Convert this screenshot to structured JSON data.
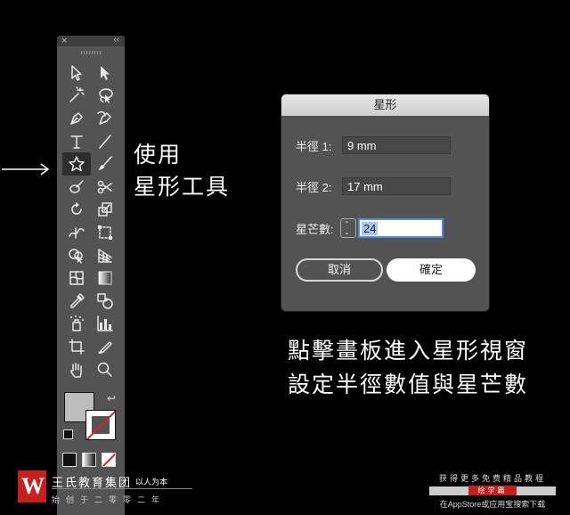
{
  "toolbar": {
    "close_glyph": "×",
    "collapse_glyph": "‹‹",
    "tools": [
      {
        "name": "selection-tool",
        "icon": "selection-arrow-icon"
      },
      {
        "name": "direct-selection-tool",
        "icon": "direct-selection-arrow-icon"
      },
      {
        "name": "magic-wand-tool",
        "icon": "magic-wand-icon"
      },
      {
        "name": "lasso-tool",
        "icon": "lasso-icon"
      },
      {
        "name": "pen-tool",
        "icon": "pen-icon"
      },
      {
        "name": "curvature-tool",
        "icon": "curvature-pen-icon"
      },
      {
        "name": "type-tool",
        "icon": "type-t-icon"
      },
      {
        "name": "line-segment-tool",
        "icon": "line-icon"
      },
      {
        "name": "star-tool",
        "icon": "star-icon",
        "selected": true
      },
      {
        "name": "paintbrush-tool",
        "icon": "paintbrush-icon"
      },
      {
        "name": "blob-brush-tool",
        "icon": "blob-brush-icon"
      },
      {
        "name": "scissors-tool",
        "icon": "scissors-icon"
      },
      {
        "name": "rotate-tool",
        "icon": "rotate-icon"
      },
      {
        "name": "scale-tool",
        "icon": "scale-icon"
      },
      {
        "name": "width-tool",
        "icon": "width-icon"
      },
      {
        "name": "free-transform-tool",
        "icon": "free-transform-icon"
      },
      {
        "name": "shape-builder-tool",
        "icon": "shape-builder-icon"
      },
      {
        "name": "perspective-grid-tool",
        "icon": "perspective-grid-icon"
      },
      {
        "name": "mesh-tool",
        "icon": "mesh-icon"
      },
      {
        "name": "gradient-tool",
        "icon": "gradient-icon"
      },
      {
        "name": "eyedropper-tool",
        "icon": "eyedropper-icon"
      },
      {
        "name": "blend-tool",
        "icon": "blend-icon"
      },
      {
        "name": "symbol-sprayer-tool",
        "icon": "symbol-sprayer-icon"
      },
      {
        "name": "column-graph-tool",
        "icon": "column-graph-icon"
      },
      {
        "name": "artboard-tool",
        "icon": "artboard-icon"
      },
      {
        "name": "slice-tool",
        "icon": "slice-icon"
      },
      {
        "name": "hand-tool",
        "icon": "hand-icon"
      },
      {
        "name": "zoom-tool",
        "icon": "zoom-icon"
      }
    ],
    "fill_color": "#bdbdbd",
    "swap_glyph": "↩"
  },
  "annotation": {
    "arrow_icon": "right-arrow-icon",
    "tool_caption_line1": "使用",
    "tool_caption_line2": "星形工具"
  },
  "dialog": {
    "title": "星形",
    "radius1_label": "半徑 1:",
    "radius1_value": "9 mm",
    "radius2_label": "半徑 2:",
    "radius2_value": "17 mm",
    "points_label": "星芒數:",
    "points_value": "24",
    "cancel_label": "取消",
    "ok_label": "確定"
  },
  "caption": {
    "line1": "點擊畫板進入星形視窗",
    "line2": "設定半徑數值與星芒數"
  },
  "brand": {
    "name": "王氏教育集团",
    "slogan": "以人为本",
    "sub": "始创于二零零二年"
  },
  "promo": {
    "top": "获得更多免费精品教程",
    "badge": "绘学霸",
    "bottom": "在AppStore或应用宝搜索下载"
  },
  "colors": {
    "accent_red": "#c7201c",
    "focus_blue": "#4a8cf0"
  }
}
